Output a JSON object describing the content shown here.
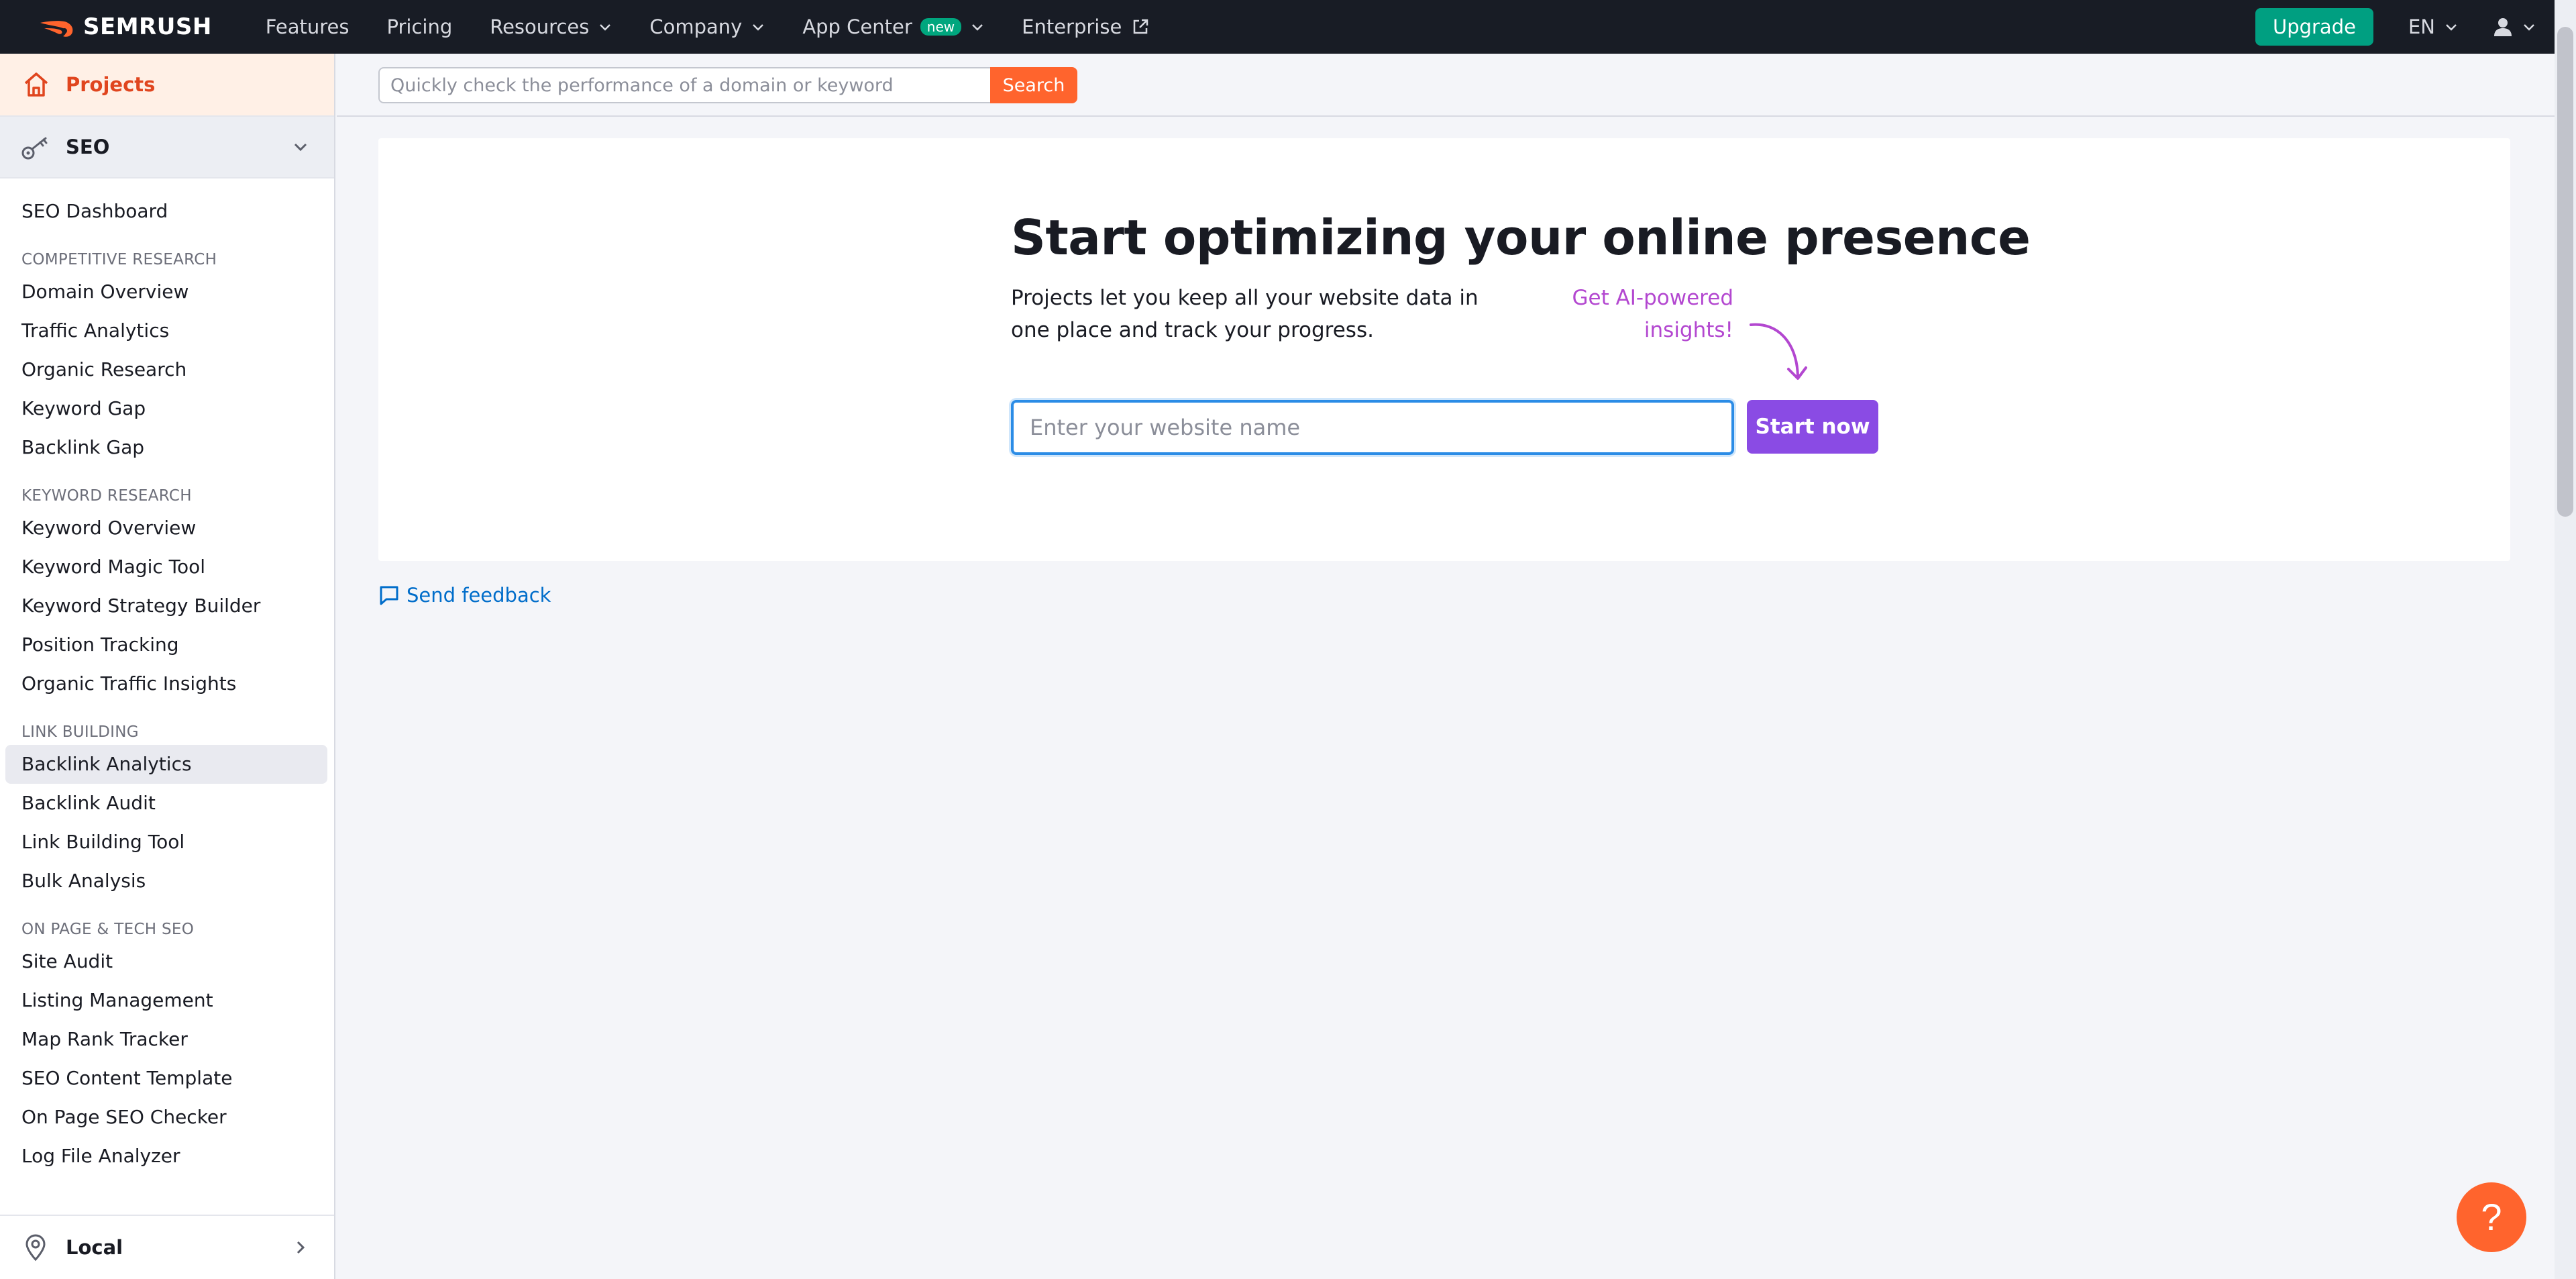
{
  "brand": {
    "name": "SEMRUSH",
    "logo_icon": "semrush-flame-icon"
  },
  "topnav": {
    "items": [
      {
        "label": "Features",
        "has_dropdown": false
      },
      {
        "label": "Pricing",
        "has_dropdown": false
      },
      {
        "label": "Resources",
        "has_dropdown": true
      },
      {
        "label": "Company",
        "has_dropdown": true
      },
      {
        "label": "App Center",
        "badge": "new",
        "has_dropdown": true
      },
      {
        "label": "Enterprise",
        "external": true
      }
    ],
    "upgrade_label": "Upgrade",
    "language": "EN",
    "user_icon": "user-icon"
  },
  "sidebar": {
    "projects_label": "Projects",
    "seo_label": "SEO",
    "dashboard": "SEO Dashboard",
    "groups": [
      {
        "title": "COMPETITIVE RESEARCH",
        "items": [
          "Domain Overview",
          "Traffic Analytics",
          "Organic Research",
          "Keyword Gap",
          "Backlink Gap"
        ]
      },
      {
        "title": "KEYWORD RESEARCH",
        "items": [
          "Keyword Overview",
          "Keyword Magic Tool",
          "Keyword Strategy Builder",
          "Position Tracking",
          "Organic Traffic Insights"
        ]
      },
      {
        "title": "LINK BUILDING",
        "items": [
          "Backlink Analytics",
          "Backlink Audit",
          "Link Building Tool",
          "Bulk Analysis"
        ]
      },
      {
        "title": "ON PAGE & TECH SEO",
        "items": [
          "Site Audit",
          "Listing Management",
          "Map Rank Tracker",
          "SEO Content Template",
          "On Page SEO Checker",
          "Log File Analyzer"
        ]
      }
    ],
    "active_item": "Backlink Analytics",
    "local_label": "Local"
  },
  "search": {
    "placeholder": "Quickly check the performance of a domain or keyword",
    "button_label": "Search"
  },
  "hero": {
    "title": "Start optimizing your online presence",
    "description": "Projects let you keep all your website data in one place and track your progress.",
    "ai_hint": "Get AI-powered insights!",
    "input_placeholder": "Enter your website name",
    "start_label": "Start now"
  },
  "feedback_label": "Send feedback",
  "help_label": "?",
  "colors": {
    "nav_bg": "#181c25",
    "accent_orange": "#ff642d",
    "upgrade_green": "#009f81",
    "start_purple": "#8a4be4",
    "ai_pink": "#b347d0",
    "link_blue": "#006dca"
  }
}
